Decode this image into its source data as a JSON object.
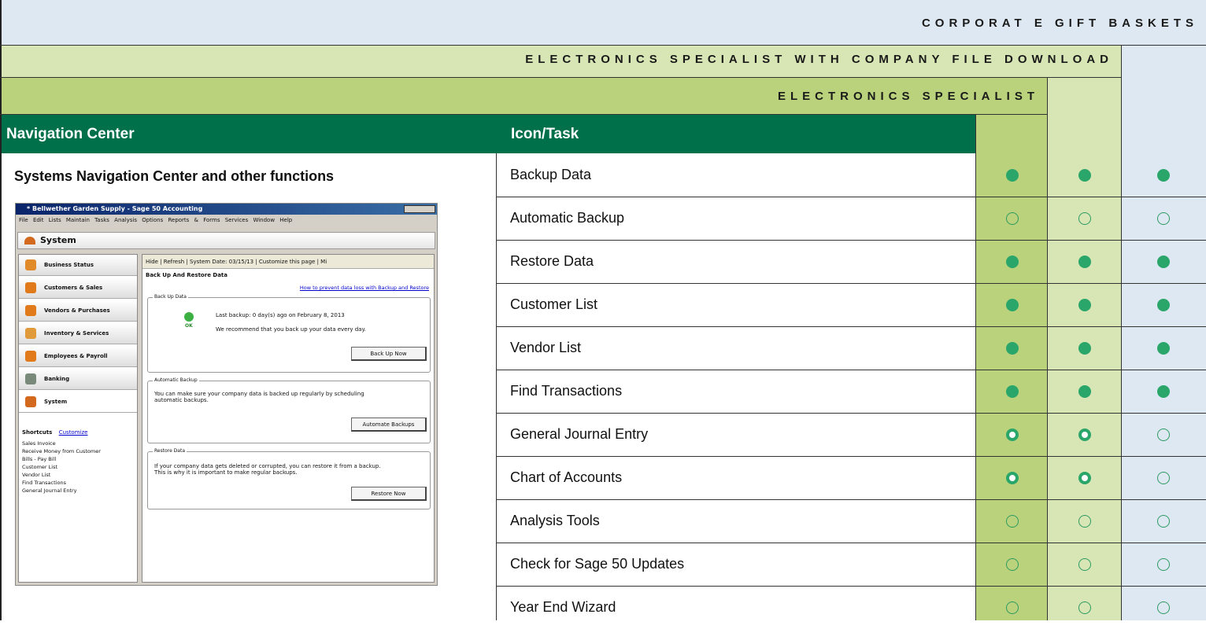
{
  "bands": {
    "corporate": "CORPORAT E GIFT BASKETS",
    "with_download": "ELECTRONICS SPECIALIST WITH COMPANY FILE DOWNLOAD",
    "specialist": "ELECTRONICS SPECIALIST"
  },
  "header": {
    "nav_center": "Navigation Center",
    "icon_task": "Icon/Task"
  },
  "section_title": "Systems Navigation Center and other functions",
  "colors": {
    "header_green": "#00704a",
    "band_dark": "#b9d27b",
    "band_mid": "#d7e6b4",
    "band_light": "#dde8f2",
    "dot_green": "#2aa66a"
  },
  "tasks": [
    {
      "label": "Backup Data",
      "marks": [
        "full",
        "full",
        "full"
      ]
    },
    {
      "label": "Automatic Backup",
      "marks": [
        "open",
        "open",
        "open"
      ]
    },
    {
      "label": "Restore Data",
      "marks": [
        "full",
        "full",
        "full"
      ]
    },
    {
      "label": "Customer List",
      "marks": [
        "full",
        "full",
        "full"
      ]
    },
    {
      "label": "Vendor List",
      "marks": [
        "full",
        "full",
        "full"
      ]
    },
    {
      "label": "Find Transactions",
      "marks": [
        "full",
        "full",
        "full"
      ]
    },
    {
      "label": "General Journal Entry",
      "marks": [
        "half",
        "half",
        "open"
      ]
    },
    {
      "label": "Chart of Accounts",
      "marks": [
        "half",
        "half",
        "open"
      ]
    },
    {
      "label": "Analysis Tools",
      "marks": [
        "open",
        "open",
        "open"
      ]
    },
    {
      "label": "Check for Sage 50 Updates",
      "marks": [
        "open",
        "open",
        "open"
      ]
    },
    {
      "label": "Year End Wizard",
      "marks": [
        "open",
        "open",
        "open"
      ]
    }
  ],
  "screenshot": {
    "title": "* Bellwether Garden Supply - Sage 50 Accounting",
    "menu": "File Edit Lists Maintain Tasks Analysis Options Reports & Forms Services Window Help",
    "system_label": "System",
    "nav_items": [
      "Business Status",
      "Customers & Sales",
      "Vendors & Purchases",
      "Inventory & Services",
      "Employees & Payroll",
      "Banking",
      "System"
    ],
    "shortcuts_label": "Shortcuts",
    "customize_label": "Customize",
    "shortcuts": [
      "Sales Invoice",
      "Receive Money from Customer",
      "Bills - Pay Bill",
      "Customer List",
      "Vendor List",
      "Find Transactions",
      "General Journal Entry"
    ],
    "toolbar": "Hide | Refresh | System Date: 03/15/13 | Customize this page | Mi",
    "panel_title": "Back Up And Restore Data",
    "help_link": "How to prevent data loss with Backup and Restore",
    "backup_group": "Back Up Data",
    "ok_label": "OK",
    "last_backup": "Last backup: 0 day(s) ago on February 8, 2013",
    "recommend": "We recommend that you back up your data every day.",
    "backup_btn": "Back Up Now",
    "auto_group": "Automatic Backup",
    "auto_text": "You can make sure your company data is backed up regularly by scheduling automatic backups.",
    "auto_btn": "Automate Backups",
    "restore_group": "Restore Data",
    "restore_text": "If your company data gets deleted or corrupted, you can restore it from a backup. This is why it is important to make regular backups.",
    "restore_btn": "Restore Now"
  }
}
